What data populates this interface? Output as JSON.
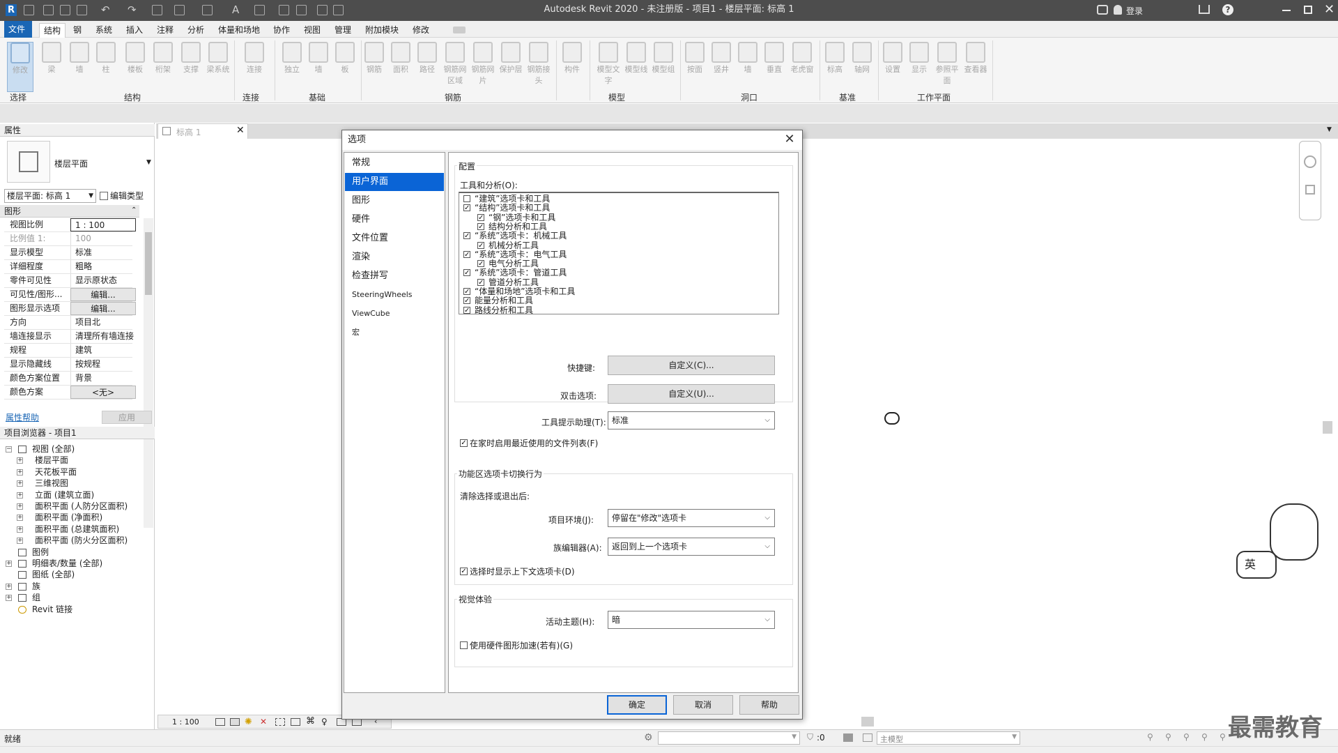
{
  "app": {
    "title": "Autodesk Revit 2020 - 未注册版 - 项目1 - 楼层平面: 标高 1",
    "login": "登录"
  },
  "tabs": [
    "文件",
    "结构",
    "钢",
    "系统",
    "插入",
    "注释",
    "分析",
    "体量和场地",
    "协作",
    "视图",
    "管理",
    "附加模块",
    "修改"
  ],
  "ribbon": {
    "buttons": [
      "修改",
      "梁",
      "墙",
      "柱",
      "楼板",
      "桁架",
      "支撑",
      "梁系统",
      "连接",
      "独立",
      "墙",
      "板",
      "钢筋",
      "面积",
      "路径",
      "钢筋网区域",
      "钢筋网片",
      "保护层",
      "钢筋接头",
      "构件",
      "模型文字",
      "模型线",
      "模型组",
      "按面",
      "竖井",
      "墙",
      "垂直",
      "老虎窗",
      "标高",
      "轴网",
      "设置",
      "显示",
      "参照平面",
      "查看器"
    ],
    "panels": [
      "选择",
      "结构",
      "连接",
      "基础",
      "钢筋",
      "模型",
      "洞口",
      "基准",
      "工作平面"
    ]
  },
  "properties": {
    "header": "属性",
    "type_name": "楼层平面",
    "view_selector": "楼层平面: 标高 1",
    "edit_type": "编辑类型",
    "section": "图形",
    "rows": [
      {
        "k": "视图比例",
        "v": "1 : 100"
      },
      {
        "k": "比例值 1:",
        "v": "100"
      },
      {
        "k": "显示模型",
        "v": "标准"
      },
      {
        "k": "详细程度",
        "v": "粗略"
      },
      {
        "k": "零件可见性",
        "v": "显示原状态"
      },
      {
        "k": "可见性/图形...",
        "v": "编辑..."
      },
      {
        "k": "图形显示选项",
        "v": "编辑..."
      },
      {
        "k": "方向",
        "v": "项目北"
      },
      {
        "k": "墙连接显示",
        "v": "清理所有墙连接"
      },
      {
        "k": "规程",
        "v": "建筑"
      },
      {
        "k": "显示隐藏线",
        "v": "按规程"
      },
      {
        "k": "颜色方案位置",
        "v": "背景"
      },
      {
        "k": "颜色方案",
        "v": "<无>"
      }
    ],
    "help": "属性帮助",
    "apply": "应用"
  },
  "browser": {
    "header": "项目浏览器 - 项目1",
    "items": [
      "视图 (全部)",
      "楼层平面",
      "天花板平面",
      "三维视图",
      "立面 (建筑立面)",
      "面积平面 (人防分区面积)",
      "面积平面 (净面积)",
      "面积平面 (总建筑面积)",
      "面积平面 (防火分区面积)",
      "图例",
      "明细表/数量 (全部)",
      "图纸 (全部)",
      "族",
      "组",
      "Revit 链接"
    ]
  },
  "view": {
    "tab": "标高 1",
    "scale": "1 : 100"
  },
  "status": {
    "text": "就绪",
    "coord": ":0",
    "model": "主模型"
  },
  "dialog": {
    "title": "选项",
    "nav": [
      "常规",
      "用户界面",
      "图形",
      "硬件",
      "文件位置",
      "渲染",
      "检查拼写",
      "SteeringWheels",
      "ViewCube",
      "宏"
    ],
    "config_title": "配置",
    "tools_label": "工具和分析(O):",
    "tools": [
      {
        "label": "“建筑”选项卡和工具",
        "checked": false,
        "indent": 0
      },
      {
        "label": "“结构”选项卡和工具",
        "checked": true,
        "indent": 0
      },
      {
        "label": "“钢”选项卡和工具",
        "checked": true,
        "indent": 1
      },
      {
        "label": "结构分析和工具",
        "checked": true,
        "indent": 1
      },
      {
        "label": "“系统”选项卡：机械工具",
        "checked": true,
        "indent": 0
      },
      {
        "label": "机械分析工具",
        "checked": true,
        "indent": 1
      },
      {
        "label": "“系统”选项卡：电气工具",
        "checked": true,
        "indent": 0
      },
      {
        "label": "电气分析工具",
        "checked": true,
        "indent": 1
      },
      {
        "label": "“系统”选项卡：管道工具",
        "checked": true,
        "indent": 0
      },
      {
        "label": "管道分析工具",
        "checked": true,
        "indent": 1
      },
      {
        "label": "“体量和场地”选项卡和工具",
        "checked": true,
        "indent": 0
      },
      {
        "label": "能量分析和工具",
        "checked": true,
        "indent": 0
      },
      {
        "label": "路线分析和工具",
        "checked": true,
        "indent": 0
      }
    ],
    "shortcut_label": "快捷键:",
    "shortcut_btn": "自定义(C)...",
    "dblclick_label": "双击选项:",
    "dblclick_btn": "自定义(U)...",
    "tooltip_label": "工具提示助理(T):",
    "tooltip_value": "标准",
    "recent_files": "在家时启用最近使用的文件列表(F)",
    "ribbon_title": "功能区选项卡切换行为",
    "after_clear": "清除选择或退出后:",
    "project_env_label": "项目环境(J):",
    "project_env_value": "停留在\"修改\"选项卡",
    "family_editor_label": "族编辑器(A):",
    "family_editor_value": "返回到上一个选项卡",
    "contextual_tab": "选择时显示上下文选项卡(D)",
    "visual_title": "视觉体验",
    "theme_label": "活动主题(H):",
    "theme_value": "暗",
    "hw_accel": "使用硬件图形加速(若有)(G)",
    "ok": "确定",
    "cancel": "取消",
    "help": "帮助"
  },
  "ime": {
    "label": "英"
  },
  "watermark": "最需教育",
  "colors": {
    "accent": "#0a64d6",
    "file_tab": "#1a66b5",
    "titlebar": "#4d4d4d"
  }
}
